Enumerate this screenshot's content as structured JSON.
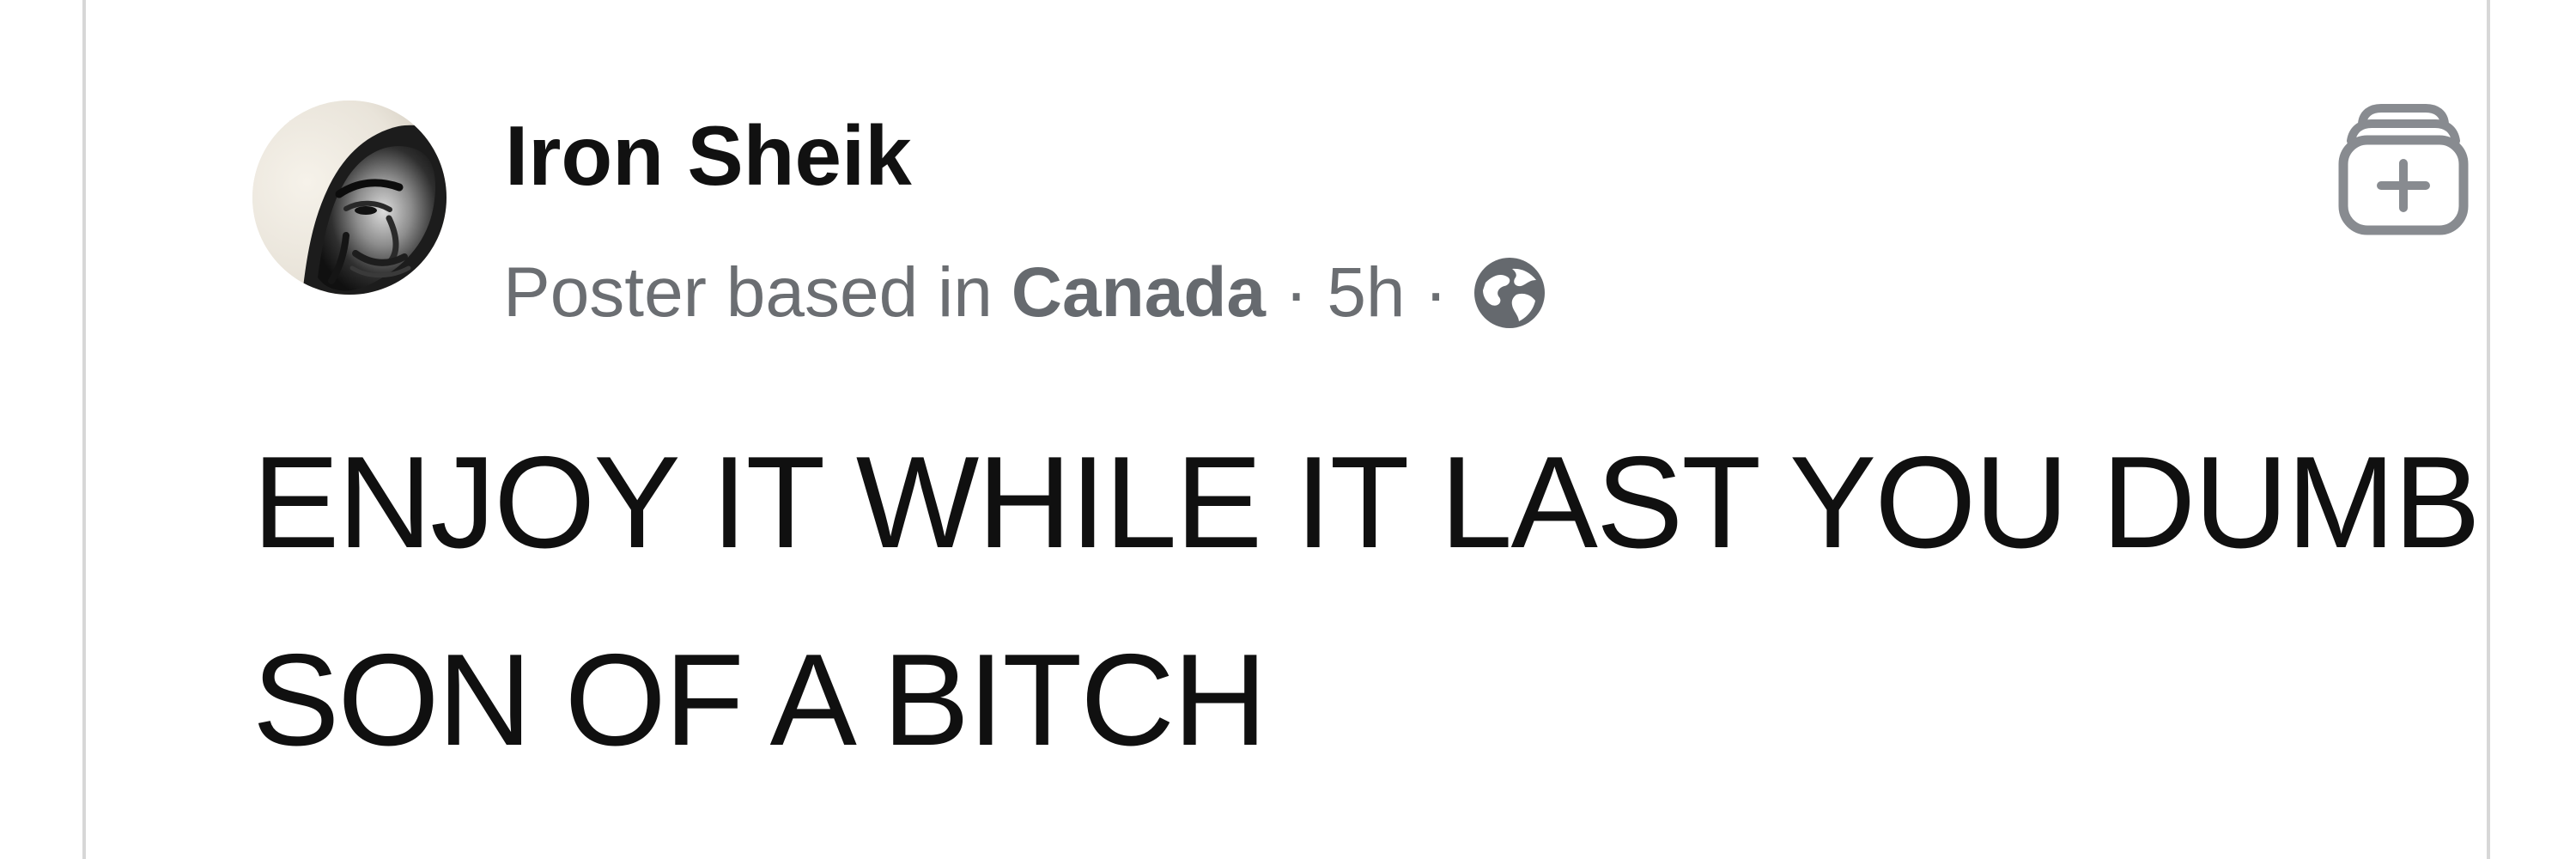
{
  "post": {
    "author": "Iron Sheik",
    "meta_prefix": "Poster based in",
    "location": "Canada",
    "separator_1": "·",
    "time": "5h",
    "separator_2": "·",
    "audience_icon": "globe-icon",
    "text": "ENJOY IT WHILE IT LAST YOU DUMB SON OF A BITCH"
  },
  "actions": {
    "save_icon": "stacked-card-add-icon"
  },
  "colors": {
    "author": "#111111",
    "meta": "#6b6e72",
    "post_text": "#101010",
    "card_border": "#d7d7d7",
    "icon": "#888b90"
  }
}
